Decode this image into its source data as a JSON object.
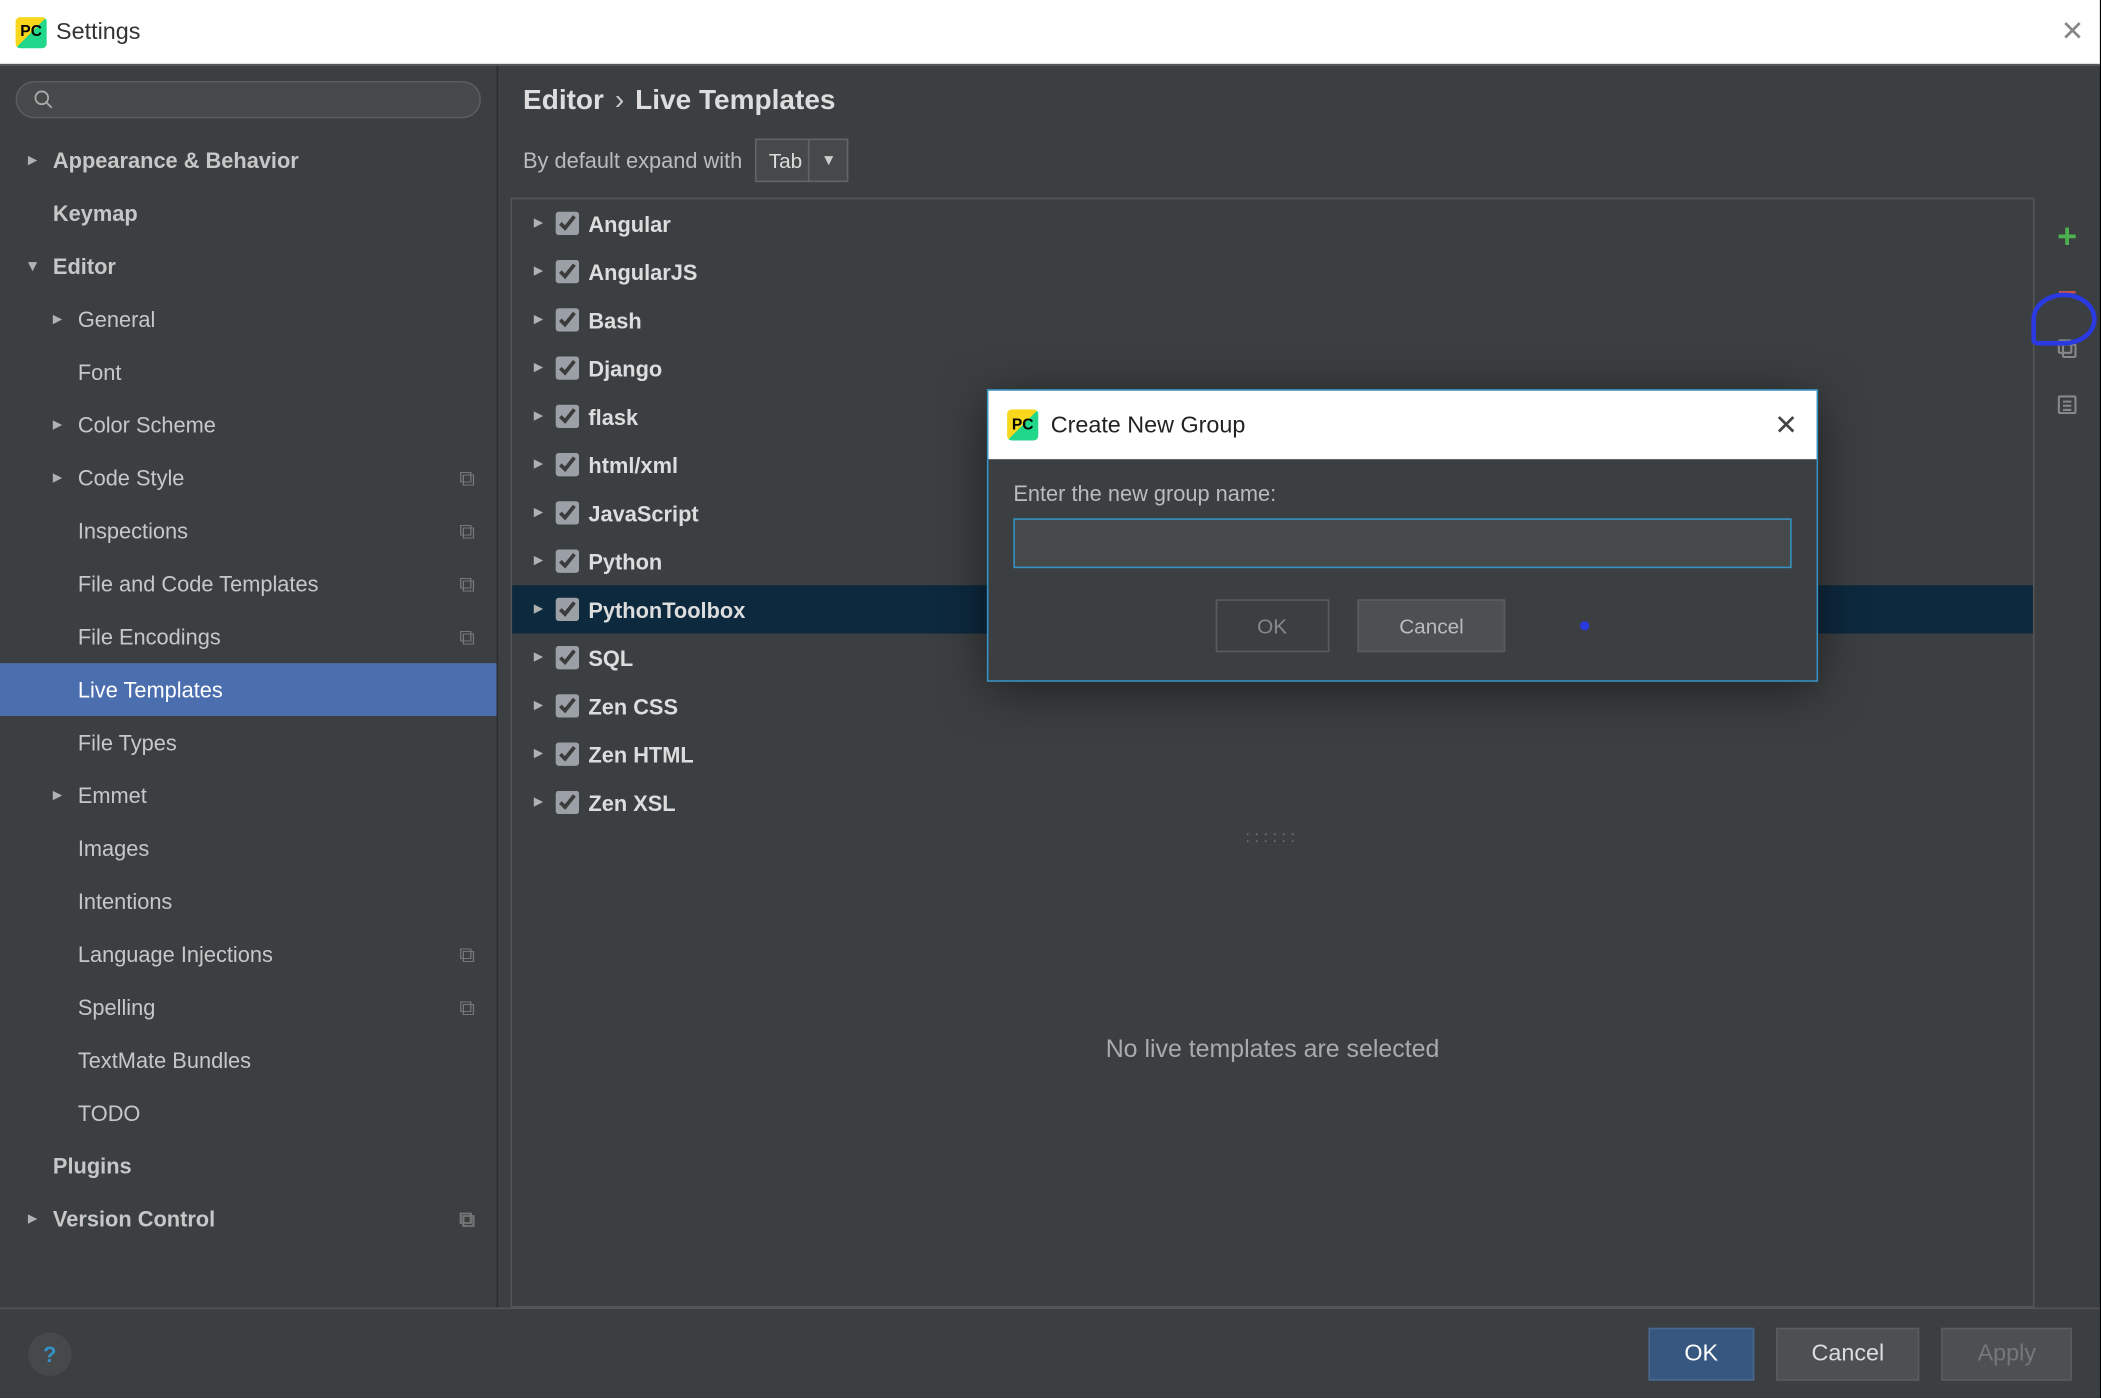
{
  "window": {
    "title": "Settings"
  },
  "sidebar": {
    "items": [
      {
        "label": "Appearance & Behavior",
        "arrow": "►",
        "bold": true,
        "lvl": 0
      },
      {
        "label": "Keymap",
        "arrow": "",
        "bold": true,
        "lvl": 0
      },
      {
        "label": "Editor",
        "arrow": "▼",
        "bold": true,
        "lvl": 0
      },
      {
        "label": "General",
        "arrow": "►",
        "bold": false,
        "lvl": 1
      },
      {
        "label": "Font",
        "arrow": "",
        "bold": false,
        "lvl": 1
      },
      {
        "label": "Color Scheme",
        "arrow": "►",
        "bold": false,
        "lvl": 1
      },
      {
        "label": "Code Style",
        "arrow": "►",
        "bold": false,
        "lvl": 1,
        "schema": true
      },
      {
        "label": "Inspections",
        "arrow": "",
        "bold": false,
        "lvl": 1,
        "schema": true
      },
      {
        "label": "File and Code Templates",
        "arrow": "",
        "bold": false,
        "lvl": 1,
        "schema": true
      },
      {
        "label": "File Encodings",
        "arrow": "",
        "bold": false,
        "lvl": 1,
        "schema": true
      },
      {
        "label": "Live Templates",
        "arrow": "",
        "bold": false,
        "lvl": 1,
        "selected": true
      },
      {
        "label": "File Types",
        "arrow": "",
        "bold": false,
        "lvl": 1
      },
      {
        "label": "Emmet",
        "arrow": "►",
        "bold": false,
        "lvl": 1
      },
      {
        "label": "Images",
        "arrow": "",
        "bold": false,
        "lvl": 1
      },
      {
        "label": "Intentions",
        "arrow": "",
        "bold": false,
        "lvl": 1
      },
      {
        "label": "Language Injections",
        "arrow": "",
        "bold": false,
        "lvl": 1,
        "schema": true
      },
      {
        "label": "Spelling",
        "arrow": "",
        "bold": false,
        "lvl": 1,
        "schema": true
      },
      {
        "label": "TextMate Bundles",
        "arrow": "",
        "bold": false,
        "lvl": 1
      },
      {
        "label": "TODO",
        "arrow": "",
        "bold": false,
        "lvl": 1
      },
      {
        "label": "Plugins",
        "arrow": "",
        "bold": true,
        "lvl": 0
      },
      {
        "label": "Version Control",
        "arrow": "►",
        "bold": true,
        "lvl": 0,
        "schema": true
      }
    ]
  },
  "breadcrumb": {
    "a": "Editor",
    "sep": "›",
    "b": "Live Templates"
  },
  "expand": {
    "label": "By default expand with",
    "value": "Tab"
  },
  "templates": [
    {
      "label": "Angular"
    },
    {
      "label": "AngularJS"
    },
    {
      "label": "Bash"
    },
    {
      "label": "Django"
    },
    {
      "label": "flask"
    },
    {
      "label": "html/xml"
    },
    {
      "label": "JavaScript"
    },
    {
      "label": "Python"
    },
    {
      "label": "PythonToolbox",
      "selected": true
    },
    {
      "label": "SQL"
    },
    {
      "label": "Zen CSS"
    },
    {
      "label": "Zen HTML"
    },
    {
      "label": "Zen XSL"
    }
  ],
  "emptyMsg": "No live templates are selected",
  "dialog": {
    "title": "Create New Group",
    "prompt": "Enter the new group name:",
    "value": "",
    "ok": "OK",
    "cancel": "Cancel"
  },
  "footer": {
    "ok": "OK",
    "cancel": "Cancel",
    "apply": "Apply"
  }
}
